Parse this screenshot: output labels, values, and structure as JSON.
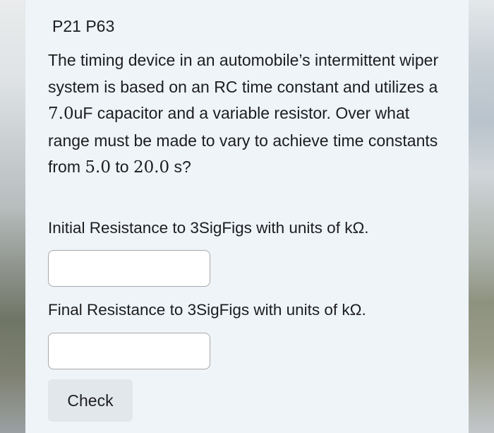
{
  "header": {
    "title": "P21 P63"
  },
  "question": {
    "text_before_capacitance": "The timing device in an automobile’s intermittent wiper system is based on an RC time constant and utilizes a ",
    "capacitance": "7.0",
    "text_after_capacitance": "uF capacitor and a variable resistor. Over what range must be made to vary to achieve time constants from ",
    "time_min": "5.0",
    "text_between_times": " to ",
    "time_max": "20.0",
    "text_end": " s?"
  },
  "fields": {
    "initial": {
      "label": "Initial Resistance to 3SigFigs with units of kΩ.",
      "value": ""
    },
    "final": {
      "label": "Final Resistance to 3SigFigs with units of kΩ.",
      "value": ""
    }
  },
  "check_button_label": "Check"
}
